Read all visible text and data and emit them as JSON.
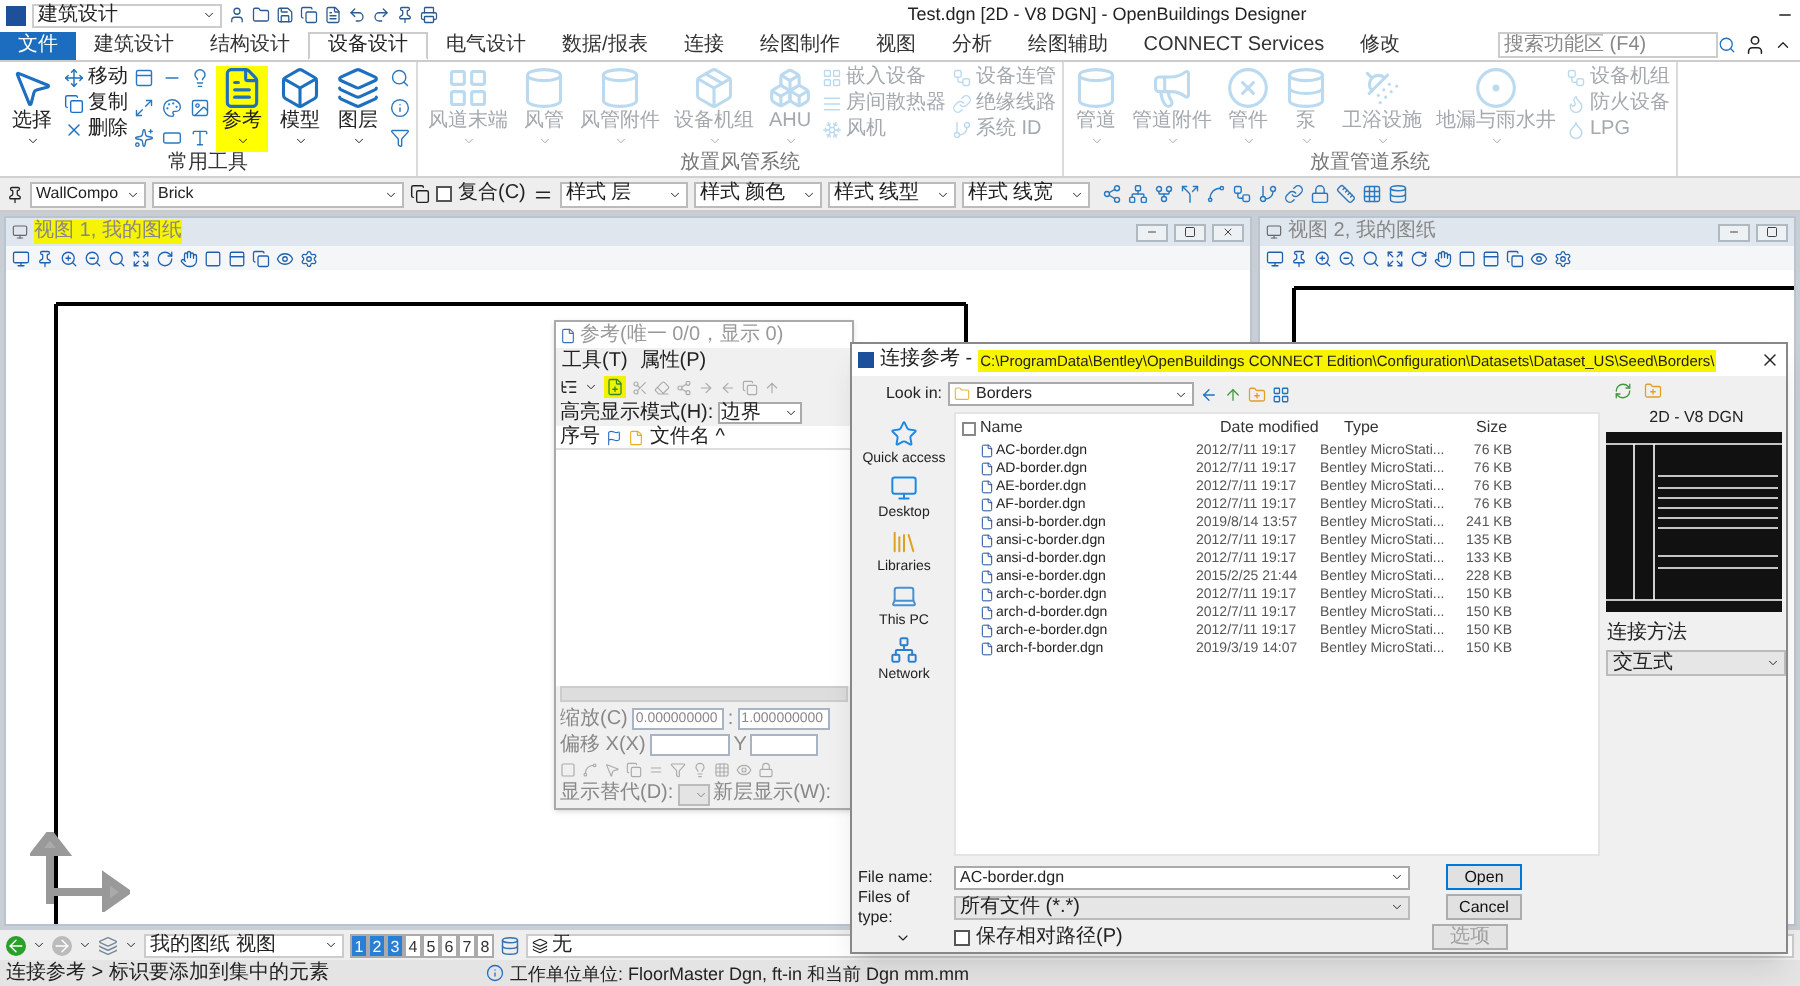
{
  "title_bar": {
    "workspace": "建筑设计",
    "title": "Test.dgn [2D - V8 DGN] - OpenBuildings Designer"
  },
  "tabs": [
    {
      "label": "文件",
      "kind": "file",
      "selected": false
    },
    {
      "label": "建筑设计",
      "kind": "tab",
      "selected": false
    },
    {
      "label": "结构设计",
      "kind": "tab",
      "selected": false
    },
    {
      "label": "设备设计",
      "kind": "tab",
      "selected": true
    },
    {
      "label": "电气设计",
      "kind": "tab",
      "selected": false
    },
    {
      "label": "数据/报表",
      "kind": "tab",
      "selected": false
    },
    {
      "label": "连接",
      "kind": "tab",
      "selected": false
    },
    {
      "label": "绘图制作",
      "kind": "tab",
      "selected": false
    },
    {
      "label": "视图",
      "kind": "tab",
      "selected": false
    },
    {
      "label": "分析",
      "kind": "tab",
      "selected": false
    },
    {
      "label": "绘图辅助",
      "kind": "tab",
      "selected": false
    },
    {
      "label": "CONNECT Services",
      "kind": "tab",
      "selected": false
    },
    {
      "label": "修改",
      "kind": "tab",
      "selected": false
    }
  ],
  "search": {
    "placeholder": "搜索功能区 (F4)"
  },
  "ribbon_groups": [
    {
      "title": "常用工具",
      "disabled": false,
      "items": [
        {
          "kind": "large",
          "label": "选择",
          "highlighted": false
        },
        {
          "kind": "small",
          "labels": [
            "移动",
            "复制",
            "删除"
          ]
        },
        {
          "kind": "icons"
        },
        {
          "kind": "large",
          "label": "参考",
          "highlighted": true
        },
        {
          "kind": "large",
          "label": "模型",
          "highlighted": false
        },
        {
          "kind": "large",
          "label": "图层",
          "highlighted": false
        },
        {
          "kind": "icons"
        }
      ]
    },
    {
      "title": "放置风管系统",
      "disabled": true,
      "items": [
        {
          "kind": "large",
          "label": "风道末端",
          "highlighted": false
        },
        {
          "kind": "large",
          "label": "风管",
          "highlighted": false
        },
        {
          "kind": "large",
          "label": "风管附件",
          "highlighted": false
        },
        {
          "kind": "large",
          "label": "设备机组",
          "highlighted": false
        },
        {
          "kind": "large",
          "label": "AHU",
          "highlighted": false
        },
        {
          "kind": "small",
          "labels": [
            "嵌入设备",
            "房间散热器",
            "风机"
          ]
        },
        {
          "kind": "small",
          "labels": [
            "设备连管",
            "绝缘线路",
            "系统 ID"
          ]
        }
      ]
    },
    {
      "title": "放置管道系统",
      "disabled": true,
      "items": [
        {
          "kind": "large",
          "label": "管道",
          "highlighted": false
        },
        {
          "kind": "large",
          "label": "管道附件",
          "highlighted": false
        },
        {
          "kind": "large",
          "label": "管件",
          "highlighted": false
        },
        {
          "kind": "large",
          "label": "泵",
          "highlighted": false
        },
        {
          "kind": "large",
          "label": "卫浴设施",
          "highlighted": false
        },
        {
          "kind": "large",
          "label": "地漏与雨水井",
          "highlighted": false
        },
        {
          "kind": "small",
          "labels": [
            "设备机组",
            "防火设备",
            "LPG"
          ]
        }
      ]
    }
  ],
  "attributes_bar": [
    {
      "kind": "dropdown",
      "value": "WallCompo"
    },
    {
      "kind": "dropdown",
      "value": "Brick"
    },
    {
      "kind": "checkbox",
      "label": "复合(C)",
      "checked": false
    },
    {
      "kind": "dropdown",
      "value": "样式 层"
    },
    {
      "kind": "dropdown",
      "value": "样式 颜色"
    },
    {
      "kind": "dropdown",
      "value": "样式 线型"
    },
    {
      "kind": "dropdown",
      "value": "样式 线宽"
    }
  ],
  "views": [
    {
      "title": "视图 1, 我的图纸",
      "highlighted": true,
      "closable": true
    },
    {
      "title": "视图 2, 我的图纸",
      "highlighted": false,
      "closable": false
    }
  ],
  "bottom_bar": {
    "view_dropdown": "我的图纸 视图",
    "view_buttons": [
      {
        "label": "1",
        "selected": true
      },
      {
        "label": "2",
        "selected": true
      },
      {
        "label": "3",
        "selected": true
      },
      {
        "label": "4",
        "selected": false
      },
      {
        "label": "5",
        "selected": false
      },
      {
        "label": "6",
        "selected": false
      },
      {
        "label": "7",
        "selected": false
      },
      {
        "label": "8",
        "selected": false
      }
    ],
    "field": "无"
  },
  "status_bar": {
    "prompt": "连接参考 > 标识要添加到集中的元素",
    "message": "工作单位单位: FloorMaster Dgn, ft-in 和当前 Dgn mm.mm"
  },
  "reference_dialog": {
    "title": "参考(唯一 0/0，显示 0)",
    "menu": [
      "工具(T)",
      "属性(P)"
    ],
    "attach_highlighted": true,
    "highlight_mode_label": "高亮显示模式(H):",
    "highlight_mode": "边界",
    "columns": [
      "序号",
      "文件名 ^"
    ],
    "scale_label": "缩放(C)",
    "scale_1": "0.000000000",
    "scale_sep": ":",
    "scale_2": "1.000000000",
    "offset_label": "偏移 X(X)",
    "offset_y_label": "Y",
    "display_label": "显示替代(D):",
    "new_level_label": "新层显示(W):"
  },
  "file_dialog": {
    "title": "连接参考 -",
    "path": "C:\\ProgramData\\Bentley\\OpenBuildings CONNECT Edition\\Configuration\\Datasets\\Dataset_US\\Seed\\Borders\\",
    "path_highlighted": true,
    "select_all_checked": false,
    "look_in_label": "Look in:",
    "look_in": "Borders",
    "places": [
      "Quick access",
      "Desktop",
      "Libraries",
      "This PC",
      "Network"
    ],
    "columns": [
      "Name",
      "Date modified",
      "Type",
      "Size"
    ],
    "files": [
      {
        "name": "AC-border.dgn",
        "date": "2012/7/11 19:17",
        "type": "Bentley MicroStati...",
        "size": "76 KB"
      },
      {
        "name": "AD-border.dgn",
        "date": "2012/7/11 19:17",
        "type": "Bentley MicroStati...",
        "size": "76 KB"
      },
      {
        "name": "AE-border.dgn",
        "date": "2012/7/11 19:17",
        "type": "Bentley MicroStati...",
        "size": "76 KB"
      },
      {
        "name": "AF-border.dgn",
        "date": "2012/7/11 19:17",
        "type": "Bentley MicroStati...",
        "size": "76 KB"
      },
      {
        "name": "ansi-b-border.dgn",
        "date": "2019/8/14 13:57",
        "type": "Bentley MicroStati...",
        "size": "241 KB"
      },
      {
        "name": "ansi-c-border.dgn",
        "date": "2012/7/11 19:17",
        "type": "Bentley MicroStati...",
        "size": "135 KB"
      },
      {
        "name": "ansi-d-border.dgn",
        "date": "2012/7/11 19:17",
        "type": "Bentley MicroStati...",
        "size": "133 KB"
      },
      {
        "name": "ansi-e-border.dgn",
        "date": "2015/2/25 21:44",
        "type": "Bentley MicroStati...",
        "size": "228 KB"
      },
      {
        "name": "arch-c-border.dgn",
        "date": "2012/7/11 19:17",
        "type": "Bentley MicroStati...",
        "size": "150 KB"
      },
      {
        "name": "arch-d-border.dgn",
        "date": "2012/7/11 19:17",
        "type": "Bentley MicroStati...",
        "size": "150 KB"
      },
      {
        "name": "arch-e-border.dgn",
        "date": "2012/7/11 19:17",
        "type": "Bentley MicroStati...",
        "size": "150 KB"
      },
      {
        "name": "arch-f-border.dgn",
        "date": "2019/3/19 14:07",
        "type": "Bentley MicroStati...",
        "size": "150 KB"
      }
    ],
    "preview_label": "2D - V8 DGN",
    "method_label": "连接方法",
    "method": "交互式",
    "file_name_label": "File name:",
    "file_name": "AC-border.dgn",
    "file_type_label": "Files of type:",
    "file_type": "所有文件 (*.*)",
    "relative_path": {
      "label": "保存相对路径(P)",
      "checked": false
    },
    "buttons": [
      {
        "label": "Open",
        "disabled": false,
        "default": true
      },
      {
        "label": "Cancel",
        "disabled": false,
        "default": false
      },
      {
        "label": "选项",
        "disabled": true,
        "default": false
      }
    ]
  }
}
